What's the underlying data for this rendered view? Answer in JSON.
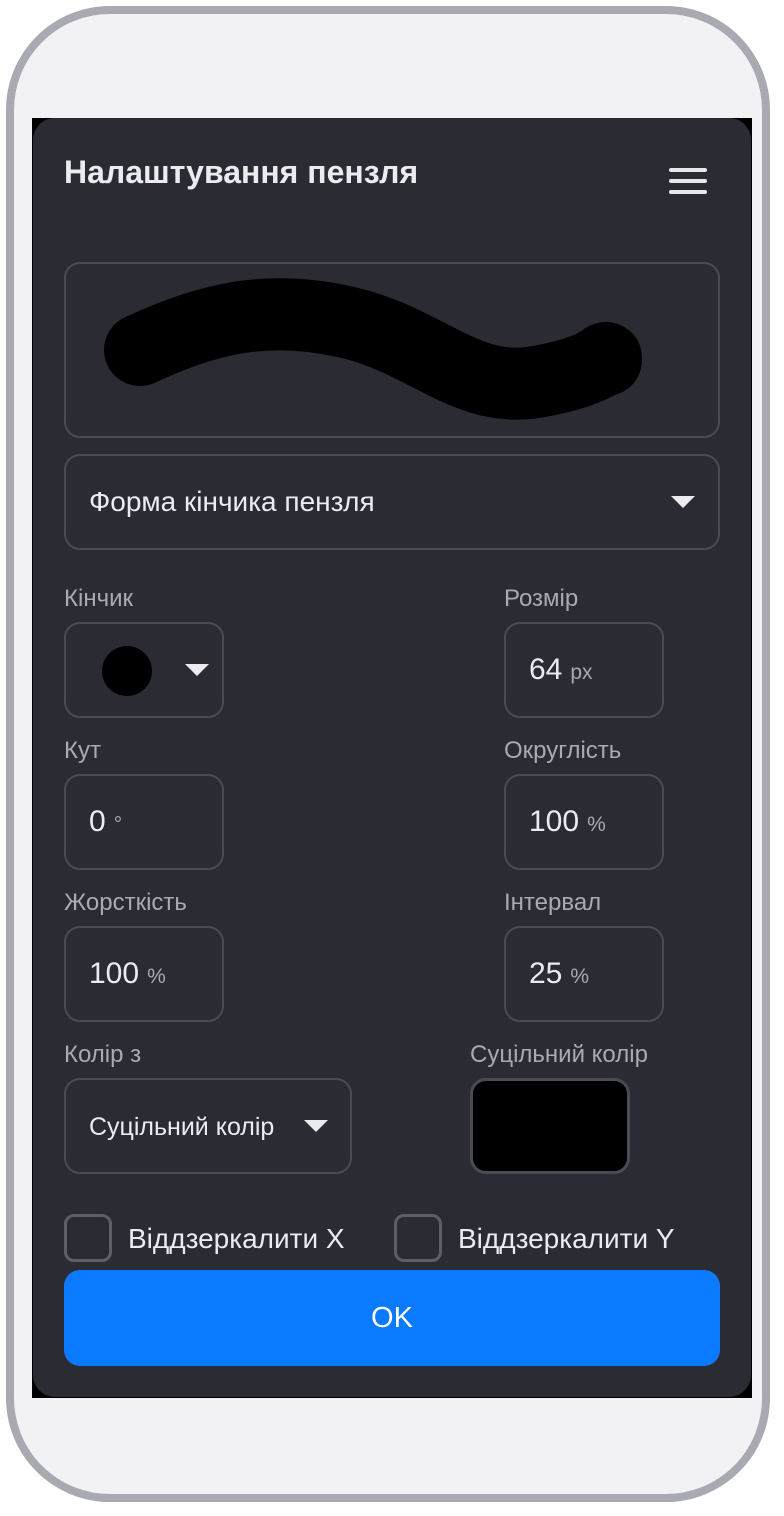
{
  "dialog": {
    "title": "Налаштування пензля",
    "menu_icon": "hamburger-menu-icon"
  },
  "brush_shape": {
    "selected": "Форма кінчика пензля"
  },
  "fields": {
    "tip_label": "Кінчик",
    "size_label": "Розмір",
    "size_value": "64",
    "size_unit": "px",
    "angle_label": "Кут",
    "angle_value": "0",
    "angle_unit": "°",
    "roundness_label": "Округлість",
    "roundness_value": "100",
    "roundness_unit": "%",
    "hardness_label": "Жорсткість",
    "hardness_value": "100",
    "hardness_unit": "%",
    "spacing_label": "Інтервал",
    "spacing_value": "25",
    "spacing_unit": "%"
  },
  "color": {
    "source_label": "Колір з",
    "source_value": "Суцільний колір",
    "solid_label": "Суцільний колір",
    "solid_color": "#000000"
  },
  "options": {
    "flip_x_label": "Віддзеркалити X",
    "flip_y_label": "Віддзеркалити Y",
    "flip_x_checked": false,
    "flip_y_checked": false
  },
  "buttons": {
    "ok_label": "OK"
  },
  "colors": {
    "accent": "#0a7bff",
    "panel": "#2a2b33",
    "border": "#4a4c55"
  }
}
